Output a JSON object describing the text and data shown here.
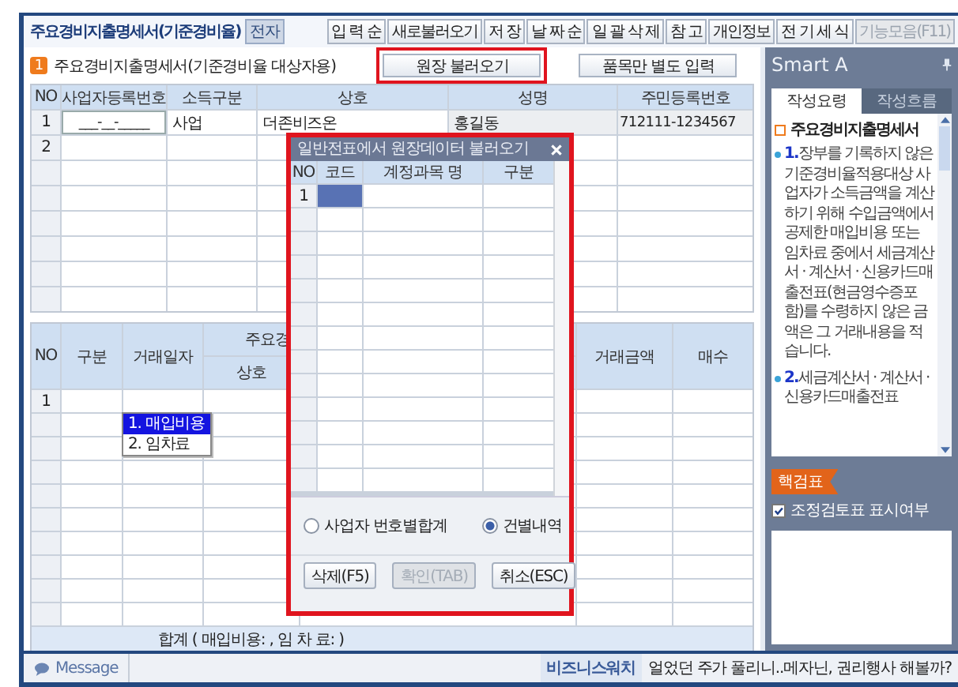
{
  "window": {
    "title": "주요경비지출명세서(기준경비율)",
    "badge": "전자"
  },
  "toolbar": [
    {
      "label": "입 력 순",
      "disabled": false
    },
    {
      "label": "새로불러오기",
      "disabled": false
    },
    {
      "label": "저 장",
      "disabled": false
    },
    {
      "label": "날 짜 순",
      "disabled": false
    },
    {
      "label": "일 괄 삭 제",
      "disabled": false
    },
    {
      "label": "참 고",
      "disabled": false
    },
    {
      "label": "개인정보",
      "disabled": false
    },
    {
      "label": "전 기 세 식",
      "disabled": false
    },
    {
      "label": "기능모음(F11)",
      "disabled": true
    }
  ],
  "section": {
    "number": "1",
    "title": "주요경비지출명세서(기준경비율 대상자용)"
  },
  "actions": [
    {
      "label": "원장 불러오기",
      "highlighted": true
    },
    {
      "label": "품목만 별도 입력",
      "highlighted": false
    }
  ],
  "upper_table": {
    "columns": [
      "NO",
      "사업자등록번호",
      "소득구분",
      "상호",
      "성명",
      "주민등록번호"
    ],
    "rows": [
      {
        "no": "1",
        "cells": [
          "___-__-_____",
          "사업",
          "더존비즈온",
          "홍길동",
          "712111-1234567"
        ]
      },
      {
        "no": "2"
      }
    ]
  },
  "lower_table": {
    "group_header": "주요경",
    "columns": [
      "NO",
      "구분",
      "거래일자",
      "상호",
      "거래금액",
      "매수"
    ],
    "rows": [
      {
        "no": "1"
      }
    ],
    "dropdown": [
      {
        "label": "1. 매입비용",
        "selected": true
      },
      {
        "label": "2. 임차료",
        "selected": false
      }
    ],
    "footer": "합계 ( 매입비용: , 임 차 료: )"
  },
  "dialog": {
    "title": "일반전표에서 원장데이터 불러오기",
    "highlighted": true,
    "columns": [
      "NO",
      "코드",
      "계정과목 명",
      "구분"
    ],
    "rows": [
      {
        "no": "1",
        "selected": true
      }
    ],
    "options": [
      {
        "label": "사업자 번호별합계",
        "selected": false
      },
      {
        "label": "건별내역",
        "selected": true
      }
    ],
    "buttons": [
      {
        "label": "삭제(F5)",
        "disabled": false
      },
      {
        "label": "확인(TAB)",
        "disabled": true
      },
      {
        "label": "취소(ESC)",
        "disabled": false
      }
    ]
  },
  "smart_panel": {
    "title": "Smart A",
    "tabs": [
      {
        "label": "작성요령",
        "selected": true
      },
      {
        "label": "작성흐름",
        "selected": false
      }
    ],
    "heading": "주요경비지출명세서",
    "items": [
      {
        "number": "1.",
        "text": "장부를 기록하지 않은 기준경비율적용대상 사업자가 소득금액을 계산하기 위해 수입금액에서 공제한 매입비용 또는 임차료 중에서 세금계산서 · 계산서 · 신용카드매출전표(현금영수증포함)를 수령하지 않은 금액은 그 거래내용을 적습니다."
      },
      {
        "number": "2.",
        "text": "세금계산서 · 계산서 · 신용카드매출전표"
      }
    ],
    "tag": "핵검표",
    "checkbox": {
      "label": "조정검토표 표시여부",
      "checked": true
    }
  },
  "status_bar": {
    "message": "Message",
    "news_source": "비즈니스워치",
    "headline": "얼었던 주가 풀리니..메자닌, 권리행사 해볼까?"
  }
}
